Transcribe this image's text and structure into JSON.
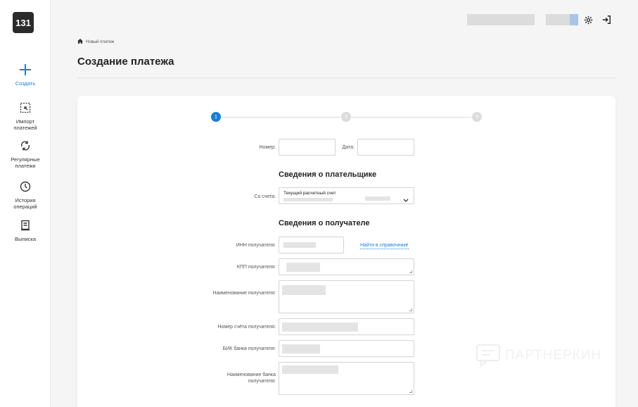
{
  "brand": {
    "logo_text": "131"
  },
  "sidebar": {
    "items": [
      {
        "label": "Создать",
        "icon": "plus-icon"
      },
      {
        "label": "Импорт платежей",
        "icon": "import-icon"
      },
      {
        "label": "Регулярные платежи",
        "icon": "recurring-icon"
      },
      {
        "label": "История операций",
        "icon": "clock-icon"
      },
      {
        "label": "Выписка",
        "icon": "statement-icon"
      }
    ]
  },
  "header": {
    "icons": [
      "settings-icon",
      "logout-icon"
    ]
  },
  "breadcrumb": {
    "current": "Новый платеж"
  },
  "page": {
    "title": "Создание платежа"
  },
  "steps": [
    "1",
    "2",
    "3"
  ],
  "form": {
    "number_label": "Номер:",
    "date_label": "Дата:",
    "payer_section": "Сведения о плательщике",
    "account_label": "Со счета:",
    "account_value": "Текущий расчетный счет",
    "recipient_section": "Сведения о получателе",
    "inn_label": "ИНН получателя:",
    "directory_link": "Найти в справочнике",
    "kpp_label": "КПП получателя:",
    "name_label": "Наименование получателя:",
    "account_number_label": "Номер счёта получателя:",
    "bik_label": "БИК банка получателя:",
    "bank_name_label": "Наименование банка получателя:"
  },
  "watermark": "ПАРТНЕРКИН",
  "colors": {
    "accent": "#1a7fd6",
    "logo_bg": "#2b2b2b"
  }
}
